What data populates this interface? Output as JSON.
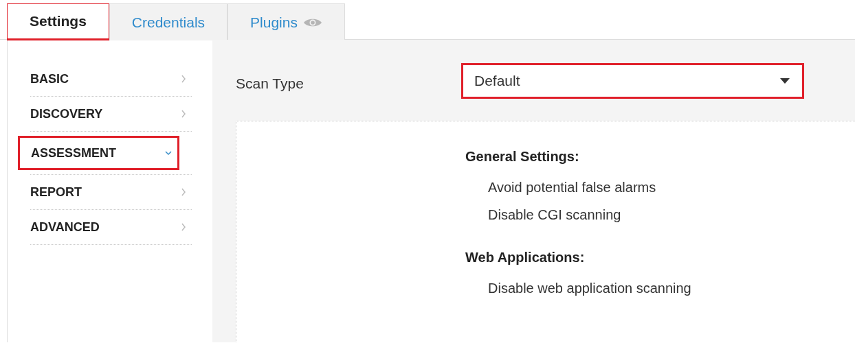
{
  "tabs": [
    {
      "label": "Settings",
      "selected": true,
      "highlighted": true
    },
    {
      "label": "Credentials",
      "selected": false,
      "highlighted": false
    },
    {
      "label": "Plugins",
      "selected": false,
      "highlighted": false,
      "kind": "eye"
    }
  ],
  "sidebar": {
    "items": [
      {
        "label": "BASIC",
        "expanded": false,
        "highlighted": false
      },
      {
        "label": "DISCOVERY",
        "expanded": false,
        "highlighted": false
      },
      {
        "label": "ASSESSMENT",
        "expanded": true,
        "highlighted": true
      },
      {
        "label": "REPORT",
        "expanded": false,
        "highlighted": false
      },
      {
        "label": "ADVANCED",
        "expanded": false,
        "highlighted": false
      }
    ]
  },
  "scan_type": {
    "label": "Scan Type",
    "value": "Default",
    "highlighted": true
  },
  "sections": [
    {
      "heading": "General Settings:",
      "items": [
        "Avoid potential false alarms",
        "Disable CGI scanning"
      ]
    },
    {
      "heading": "Web Applications:",
      "items": [
        "Disable web application scanning"
      ]
    }
  ]
}
